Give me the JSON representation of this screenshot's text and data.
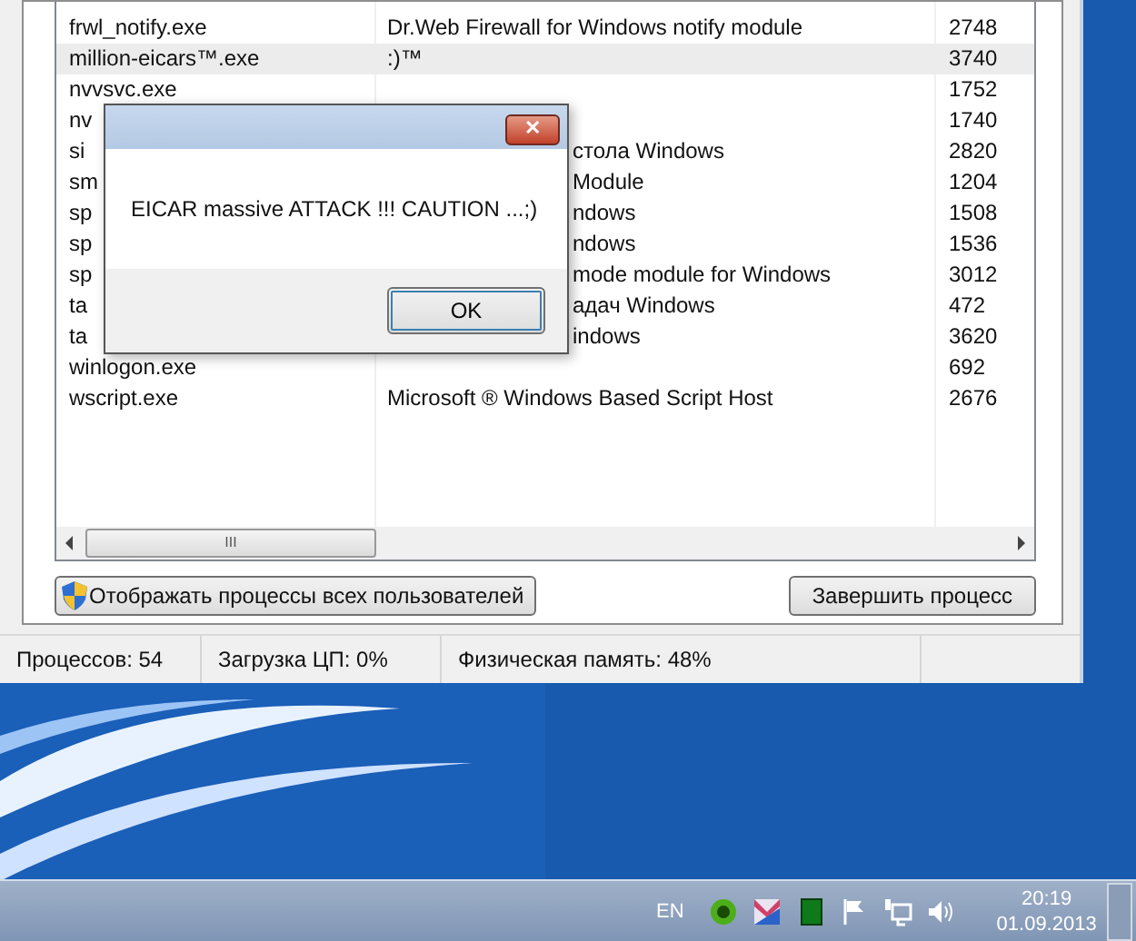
{
  "process_list": {
    "rows": [
      {
        "name": "frwl_notify.exe",
        "description": "Dr.Web Firewall for Windows notify module",
        "pid": "2748",
        "selected": false
      },
      {
        "name": "million-eicars™.exe",
        "description": ":)™",
        "pid": "3740",
        "selected": true
      },
      {
        "name": "nvvsvc.exe",
        "description": "",
        "pid": "1752",
        "selected": false
      },
      {
        "name": "nv",
        "description": "",
        "pid": "1740",
        "selected": false
      },
      {
        "name": "si",
        "description": "стола Windows",
        "pid": "2820",
        "selected": false,
        "covered": true
      },
      {
        "name": "sm",
        "description": "Module",
        "pid": "1204",
        "selected": false,
        "covered": true
      },
      {
        "name": "sp",
        "description": "ndows",
        "pid": "1508",
        "selected": false,
        "covered": true
      },
      {
        "name": "sp",
        "description": "ndows",
        "pid": "1536",
        "selected": false,
        "covered": true
      },
      {
        "name": "sp",
        "description": "mode module for Windows",
        "pid": "3012",
        "selected": false,
        "covered": true
      },
      {
        "name": "ta",
        "description": "адач Windows",
        "pid": "472",
        "selected": false,
        "covered": true
      },
      {
        "name": "ta",
        "description": "indows",
        "pid": "3620",
        "selected": false,
        "covered": true
      },
      {
        "name": "winlogon.exe",
        "description": "",
        "pid": "692",
        "selected": false
      },
      {
        "name": "wscript.exe",
        "description": "Microsoft ® Windows Based Script Host",
        "pid": "2676",
        "selected": false
      }
    ]
  },
  "buttons": {
    "show_all": "Отображать процессы всех пользователей",
    "end_process": "Завершить процесс",
    "scroll_grip": "III"
  },
  "status_bar": [
    "Процессов: 54",
    "Загрузка ЦП: 0%",
    "Физическая память: 48%"
  ],
  "dialog": {
    "close": "✕",
    "message": "EICAR massive ATTACK !!! CAUTION ...;)",
    "ok": "OK"
  },
  "taskbar": {
    "language": "EN",
    "time": "20:19",
    "date": "01.09.2013"
  }
}
